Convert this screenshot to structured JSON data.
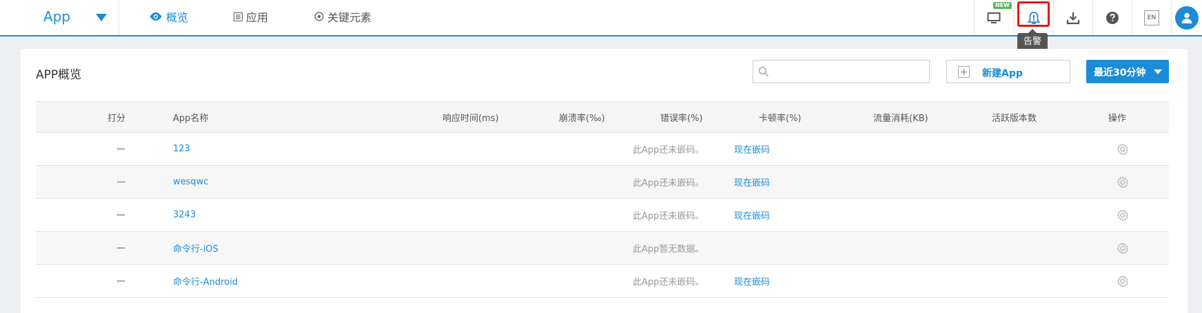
{
  "topbar": {
    "app_name": "App",
    "nav": [
      {
        "label": "概览",
        "active": true,
        "icon": "eye-icon"
      },
      {
        "label": "应用",
        "active": false,
        "icon": "list-icon"
      },
      {
        "label": "关键元素",
        "active": false,
        "icon": "target-icon"
      }
    ],
    "tools": {
      "new_badge": "NEW",
      "lang": "EN",
      "alert_tooltip": "告警"
    }
  },
  "panel": {
    "title": "APP概览",
    "search_placeholder": "",
    "new_app_label": "新建App",
    "time_range_label": "最近30分钟"
  },
  "table": {
    "headers": {
      "score": "打分",
      "name": "App名称",
      "response": "响应时间(ms)",
      "crash": "崩溃率(‰)",
      "error": "错误率(%)",
      "lag": "卡顿率(%)",
      "traffic": "流量消耗(KB)",
      "versions": "活跃版本数",
      "actions": "操作"
    },
    "rows": [
      {
        "score": "—",
        "name": "123",
        "message": "此App还未嵌码。",
        "embed_link": "现在嵌码"
      },
      {
        "score": "—",
        "name": "wesqwc",
        "message": "此App还未嵌码。",
        "embed_link": "现在嵌码"
      },
      {
        "score": "—",
        "name": "3243",
        "message": "此App还未嵌码。",
        "embed_link": "现在嵌码"
      },
      {
        "score": "—",
        "name": "命令行-iOS",
        "message": "此App暂无数据。",
        "embed_link": ""
      },
      {
        "score": "—",
        "name": "命令行-Android",
        "message": "此App还未嵌码。",
        "embed_link": "现在嵌码"
      }
    ]
  },
  "colors": {
    "accent": "#1c8cd6",
    "alert_highlight": "#e51414"
  }
}
